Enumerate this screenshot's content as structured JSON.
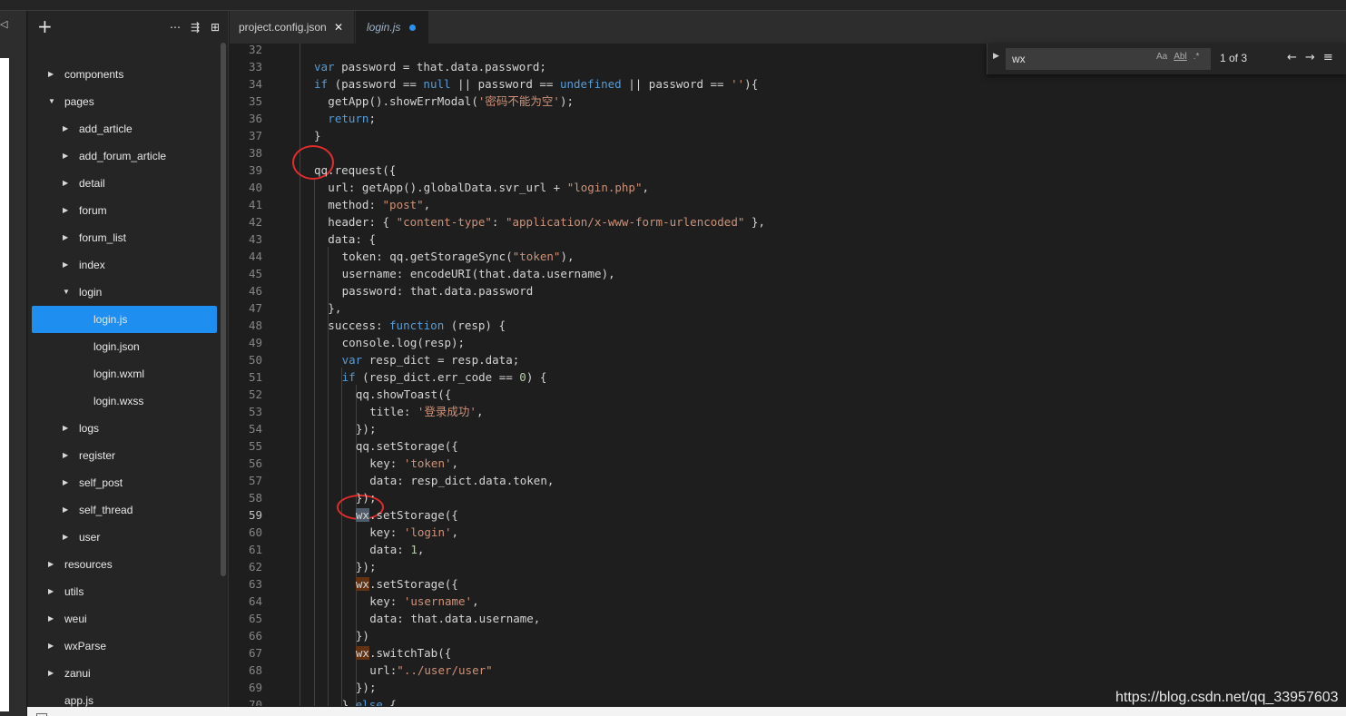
{
  "explorer": {
    "add_label": "+",
    "header_icons": [
      "⋯",
      "⇶",
      "⊞"
    ],
    "items": [
      {
        "label": "components",
        "depth": 0,
        "expanded": false,
        "folder": true
      },
      {
        "label": "pages",
        "depth": 0,
        "expanded": true,
        "folder": true
      },
      {
        "label": "add_article",
        "depth": 1,
        "expanded": false,
        "folder": true
      },
      {
        "label": "add_forum_article",
        "depth": 1,
        "expanded": false,
        "folder": true
      },
      {
        "label": "detail",
        "depth": 1,
        "expanded": false,
        "folder": true
      },
      {
        "label": "forum",
        "depth": 1,
        "expanded": false,
        "folder": true
      },
      {
        "label": "forum_list",
        "depth": 1,
        "expanded": false,
        "folder": true
      },
      {
        "label": "index",
        "depth": 1,
        "expanded": false,
        "folder": true
      },
      {
        "label": "login",
        "depth": 1,
        "expanded": true,
        "folder": true
      },
      {
        "label": "login.js",
        "depth": 2,
        "folder": false,
        "selected": true
      },
      {
        "label": "login.json",
        "depth": 2,
        "folder": false
      },
      {
        "label": "login.wxml",
        "depth": 2,
        "folder": false
      },
      {
        "label": "login.wxss",
        "depth": 2,
        "folder": false
      },
      {
        "label": "logs",
        "depth": 1,
        "expanded": false,
        "folder": true
      },
      {
        "label": "register",
        "depth": 1,
        "expanded": false,
        "folder": true
      },
      {
        "label": "self_post",
        "depth": 1,
        "expanded": false,
        "folder": true
      },
      {
        "label": "self_thread",
        "depth": 1,
        "expanded": false,
        "folder": true
      },
      {
        "label": "user",
        "depth": 1,
        "expanded": false,
        "folder": true
      },
      {
        "label": "resources",
        "depth": 0,
        "expanded": false,
        "folder": true
      },
      {
        "label": "utils",
        "depth": 0,
        "expanded": false,
        "folder": true
      },
      {
        "label": "weui",
        "depth": 0,
        "expanded": false,
        "folder": true
      },
      {
        "label": "wxParse",
        "depth": 0,
        "expanded": false,
        "folder": true
      },
      {
        "label": "zanui",
        "depth": 0,
        "expanded": false,
        "folder": true
      },
      {
        "label": "app.js",
        "depth": 0,
        "folder": false
      }
    ]
  },
  "tabs": [
    {
      "label": "project.config.json",
      "close": "✕"
    },
    {
      "label": "login.js",
      "modified": true
    }
  ],
  "find": {
    "query": "wx",
    "match_case": "Aa",
    "whole_word": "Abl",
    "regex": ".*",
    "count": "1 of 3",
    "prev": "←",
    "next": "→",
    "menu": "≡",
    "toggle": "▶"
  },
  "editor": {
    "active_line": 59,
    "lines": [
      {
        "n": "32",
        "indent": 2,
        "segs": []
      },
      {
        "n": "33",
        "indent": 2,
        "segs": [
          [
            "var",
            "kw"
          ],
          [
            " password = that.data.password;",
            ""
          ]
        ]
      },
      {
        "n": "34",
        "indent": 2,
        "segs": [
          [
            "if",
            "kw"
          ],
          [
            " (password == ",
            ""
          ],
          [
            "null",
            "kw"
          ],
          [
            " || password == ",
            ""
          ],
          [
            "undefined",
            "kw"
          ],
          [
            " || password == ",
            ""
          ],
          [
            "''",
            "str"
          ],
          [
            "){",
            ""
          ]
        ]
      },
      {
        "n": "35",
        "indent": 3,
        "segs": [
          [
            "getApp().showErrModal(",
            ""
          ],
          [
            "'密码不能为空'",
            "str"
          ],
          [
            ");",
            ""
          ]
        ]
      },
      {
        "n": "36",
        "indent": 3,
        "segs": [
          [
            "return",
            "kw"
          ],
          [
            ";",
            ""
          ]
        ]
      },
      {
        "n": "37",
        "indent": 2,
        "segs": [
          [
            "}",
            ""
          ]
        ]
      },
      {
        "n": "38",
        "indent": 2,
        "segs": []
      },
      {
        "n": "39",
        "indent": 2,
        "segs": [
          [
            "qq.request({",
            ""
          ]
        ]
      },
      {
        "n": "40",
        "indent": 3,
        "segs": [
          [
            "url: getApp().globalData.svr_url + ",
            ""
          ],
          [
            "\"login.php\"",
            "str"
          ],
          [
            ",",
            ""
          ]
        ]
      },
      {
        "n": "41",
        "indent": 3,
        "segs": [
          [
            "method: ",
            ""
          ],
          [
            "\"post\"",
            "str"
          ],
          [
            ",",
            ""
          ]
        ]
      },
      {
        "n": "42",
        "indent": 3,
        "segs": [
          [
            "header: { ",
            ""
          ],
          [
            "\"content-type\"",
            "str"
          ],
          [
            ": ",
            ""
          ],
          [
            "\"application/x-www-form-urlencoded\"",
            "str"
          ],
          [
            " },",
            ""
          ]
        ]
      },
      {
        "n": "43",
        "indent": 3,
        "segs": [
          [
            "data: {",
            ""
          ]
        ]
      },
      {
        "n": "44",
        "indent": 4,
        "segs": [
          [
            "token: qq.getStorageSync(",
            ""
          ],
          [
            "\"token\"",
            "str"
          ],
          [
            "),",
            ""
          ]
        ]
      },
      {
        "n": "45",
        "indent": 4,
        "segs": [
          [
            "username: encodeURI(that.data.username),",
            ""
          ]
        ]
      },
      {
        "n": "46",
        "indent": 4,
        "segs": [
          [
            "password: that.data.password",
            ""
          ]
        ]
      },
      {
        "n": "47",
        "indent": 3,
        "segs": [
          [
            "},",
            ""
          ]
        ]
      },
      {
        "n": "48",
        "indent": 3,
        "segs": [
          [
            "success: ",
            ""
          ],
          [
            "function",
            "kw"
          ],
          [
            " (resp) {",
            ""
          ]
        ]
      },
      {
        "n": "49",
        "indent": 4,
        "segs": [
          [
            "console.log(resp);",
            ""
          ]
        ]
      },
      {
        "n": "50",
        "indent": 4,
        "segs": [
          [
            "var",
            "kw"
          ],
          [
            " resp_dict = resp.data;",
            ""
          ]
        ]
      },
      {
        "n": "51",
        "indent": 4,
        "segs": [
          [
            "if",
            "kw"
          ],
          [
            " (resp_dict.err_code == ",
            ""
          ],
          [
            "0",
            "num-lit"
          ],
          [
            ") {",
            ""
          ]
        ]
      },
      {
        "n": "52",
        "indent": 5,
        "segs": [
          [
            "qq.showToast({",
            ""
          ]
        ]
      },
      {
        "n": "53",
        "indent": 6,
        "segs": [
          [
            "title: ",
            ""
          ],
          [
            "'登录成功'",
            "str"
          ],
          [
            ",",
            ""
          ]
        ]
      },
      {
        "n": "54",
        "indent": 5,
        "segs": [
          [
            "});",
            ""
          ]
        ]
      },
      {
        "n": "55",
        "indent": 5,
        "segs": [
          [
            "qq.setStorage({",
            ""
          ]
        ]
      },
      {
        "n": "56",
        "indent": 6,
        "segs": [
          [
            "key: ",
            ""
          ],
          [
            "'token'",
            "str"
          ],
          [
            ",",
            ""
          ]
        ]
      },
      {
        "n": "57",
        "indent": 6,
        "segs": [
          [
            "data: resp_dict.data.token,",
            ""
          ]
        ]
      },
      {
        "n": "58",
        "indent": 5,
        "segs": [
          [
            "});",
            ""
          ]
        ]
      },
      {
        "n": "59",
        "indent": 5,
        "segs": [
          [
            "wx",
            "hl-cur"
          ],
          [
            ".setStorage({",
            ""
          ]
        ]
      },
      {
        "n": "60",
        "indent": 6,
        "segs": [
          [
            "key: ",
            ""
          ],
          [
            "'login'",
            "str"
          ],
          [
            ",",
            ""
          ]
        ]
      },
      {
        "n": "61",
        "indent": 6,
        "segs": [
          [
            "data: ",
            ""
          ],
          [
            "1",
            "num-lit"
          ],
          [
            ",",
            ""
          ]
        ]
      },
      {
        "n": "62",
        "indent": 5,
        "segs": [
          [
            "});",
            ""
          ]
        ]
      },
      {
        "n": "63",
        "indent": 5,
        "segs": [
          [
            "wx",
            "hl"
          ],
          [
            ".setStorage({",
            ""
          ]
        ]
      },
      {
        "n": "64",
        "indent": 6,
        "segs": [
          [
            "key: ",
            ""
          ],
          [
            "'username'",
            "str"
          ],
          [
            ",",
            ""
          ]
        ]
      },
      {
        "n": "65",
        "indent": 6,
        "segs": [
          [
            "data: that.data.username,",
            ""
          ]
        ]
      },
      {
        "n": "66",
        "indent": 5,
        "segs": [
          [
            "})",
            ""
          ]
        ]
      },
      {
        "n": "67",
        "indent": 5,
        "segs": [
          [
            "wx",
            "hl"
          ],
          [
            ".switchTab({",
            ""
          ]
        ]
      },
      {
        "n": "68",
        "indent": 6,
        "segs": [
          [
            "url:",
            ""
          ],
          [
            "\"../user/user\"",
            "str"
          ]
        ]
      },
      {
        "n": "69",
        "indent": 5,
        "segs": [
          [
            "});",
            ""
          ]
        ]
      },
      {
        "n": "70",
        "indent": 4,
        "segs": [
          [
            "} ",
            ""
          ],
          [
            "else",
            "kw"
          ],
          [
            " {",
            ""
          ]
        ]
      }
    ]
  },
  "watermark": "https://blog.csdn.net/qq_33957603",
  "colors": {
    "accent": "#1e8ef0",
    "keyword": "#569cd6",
    "string": "#ce9178",
    "annotation": "#e02c2c"
  }
}
